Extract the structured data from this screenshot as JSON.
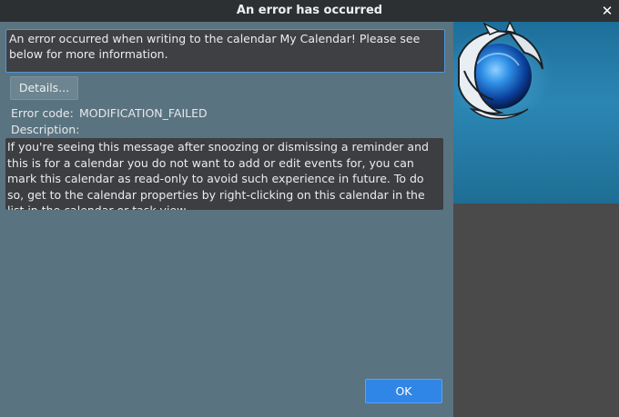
{
  "window": {
    "title": "An error has occurred",
    "close_glyph": "✕"
  },
  "error": {
    "summary": "An error occurred when writing to the calendar My Calendar! Please see below for more information.",
    "details_label": "Details...",
    "code_label": "Error code:",
    "code_value": "MODIFICATION_FAILED",
    "description_label": "Description:",
    "description_text": "If you're seeing this message after snoozing or dismissing a reminder and this is for a calendar you do not want to add or edit events for, you can mark this calendar as read-only to avoid such experience in future. To do so, get to the calendar properties by right-clicking on this calendar in the list in the calendar or task view."
  },
  "actions": {
    "ok_label": "OK"
  },
  "icons": {
    "close": "close-icon",
    "logo": "fox-globe-logo-icon"
  },
  "colors": {
    "accent": "#2f86e6",
    "window_bg": "#5a7380",
    "titlebar_bg": "#2d3033",
    "text_field_bg": "#3f4043",
    "side_panel_bg": "#4a4a4a"
  }
}
